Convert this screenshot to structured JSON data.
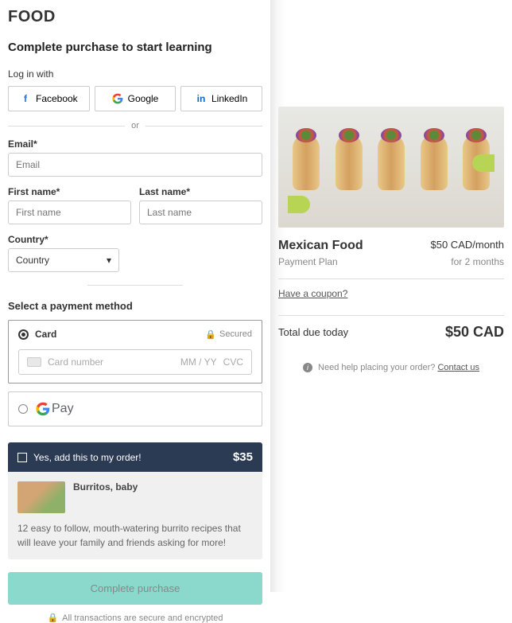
{
  "logo": "FOOD",
  "heading": "Complete purchase to start learning",
  "login": {
    "label": "Log in with",
    "facebook": "Facebook",
    "google": "Google",
    "linkedin": "LinkedIn",
    "or": "or"
  },
  "fields": {
    "email_label": "Email*",
    "email_placeholder": "Email",
    "first_name_label": "First name*",
    "first_name_placeholder": "First name",
    "last_name_label": "Last name*",
    "last_name_placeholder": "Last name",
    "country_label": "Country*",
    "country_placeholder": "Country"
  },
  "payment": {
    "section_title": "Select a payment method",
    "card_label": "Card",
    "secured_label": "Secured",
    "card_number_placeholder": "Card number",
    "expiry_placeholder": "MM / YY",
    "cvc_placeholder": "CVC",
    "gpay_label": "Pay"
  },
  "upsell": {
    "add_label": "Yes, add this to my order!",
    "price": "$35",
    "title": "Burritos, baby",
    "description": "12 easy to follow, mouth-watering burrito recipes that will leave your family and friends asking for more!"
  },
  "complete_button": "Complete purchase",
  "secure_note": "All transactions are secure and encrypted",
  "order": {
    "product_name": "Mexican Food",
    "price_line": "$50 CAD/month",
    "plan_label": "Payment Plan",
    "duration": "for 2 months",
    "coupon_link": "Have a coupon?",
    "total_label": "Total due today",
    "total_amount": "$50 CAD",
    "help_text": "Need help placing your order?",
    "contact_link": "Contact us"
  }
}
